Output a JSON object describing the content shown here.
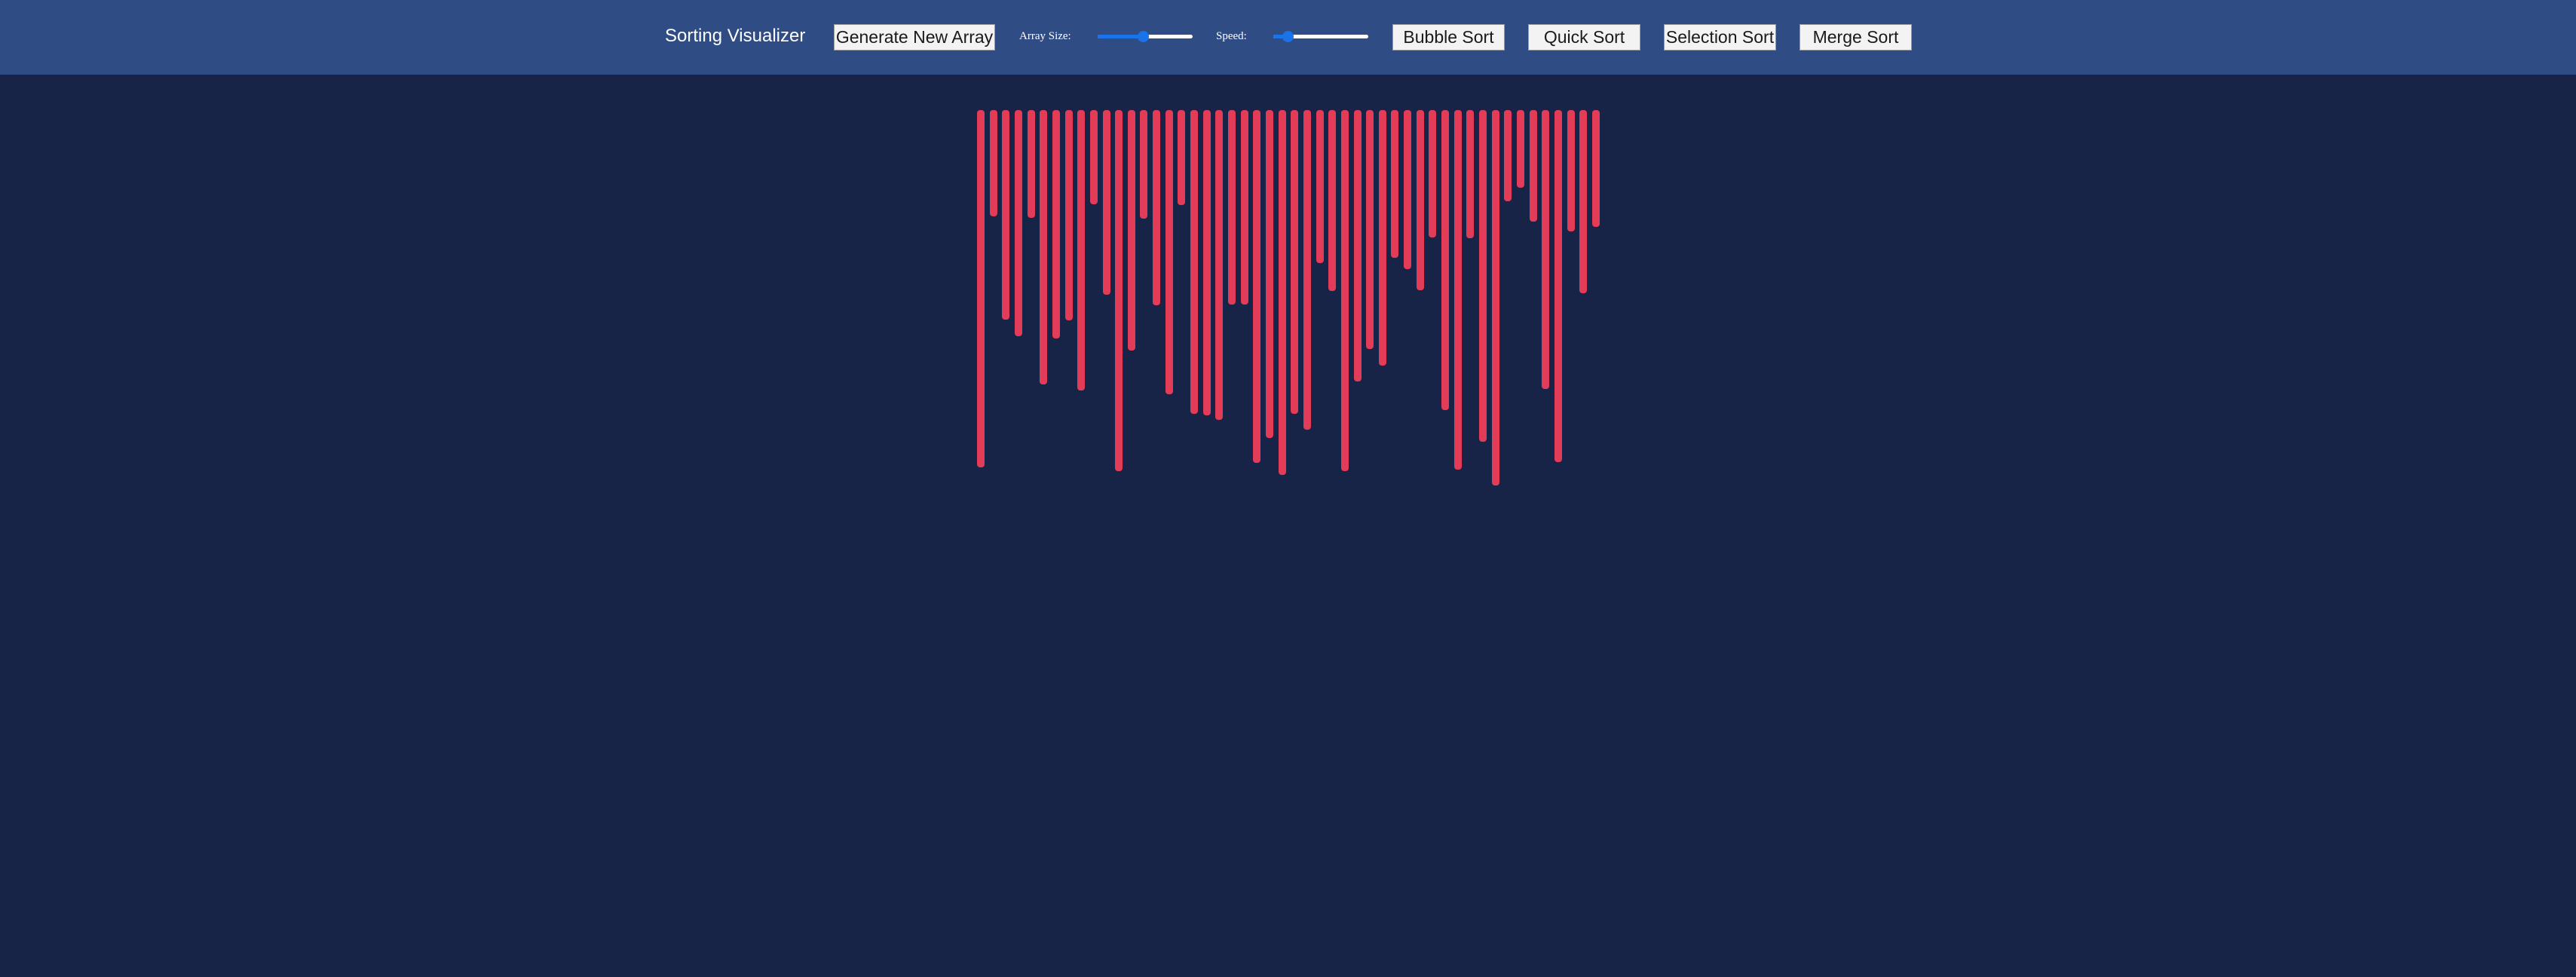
{
  "navbar": {
    "title": "Sorting Visualizer",
    "generate_label": "Generate New Array",
    "array_size_label": "Array Size:",
    "speed_label": "Speed:",
    "bubble_label": "Bubble Sort",
    "quick_label": "Quick Sort",
    "selection_label": "Selection Sort",
    "merge_label": "Merge Sort"
  },
  "controls": {
    "array_size_fraction": 0.48,
    "speed_fraction": 0.15
  },
  "colors": {
    "background": "#172347",
    "navbar": "#304c85",
    "bar": "#e23c58",
    "slider_accent": "#1a73e8"
  },
  "array": {
    "values": [
      474,
      141,
      278,
      300,
      143,
      364,
      303,
      279,
      372,
      125,
      245,
      479,
      319,
      144,
      259,
      377,
      126,
      403,
      405,
      411,
      258,
      258,
      468,
      435,
      484,
      403,
      424,
      203,
      240,
      479,
      360,
      317,
      339,
      196,
      211,
      239,
      169,
      398,
      477,
      170,
      440,
      498,
      121,
      103,
      148,
      370,
      467,
      161,
      243,
      155
    ]
  }
}
